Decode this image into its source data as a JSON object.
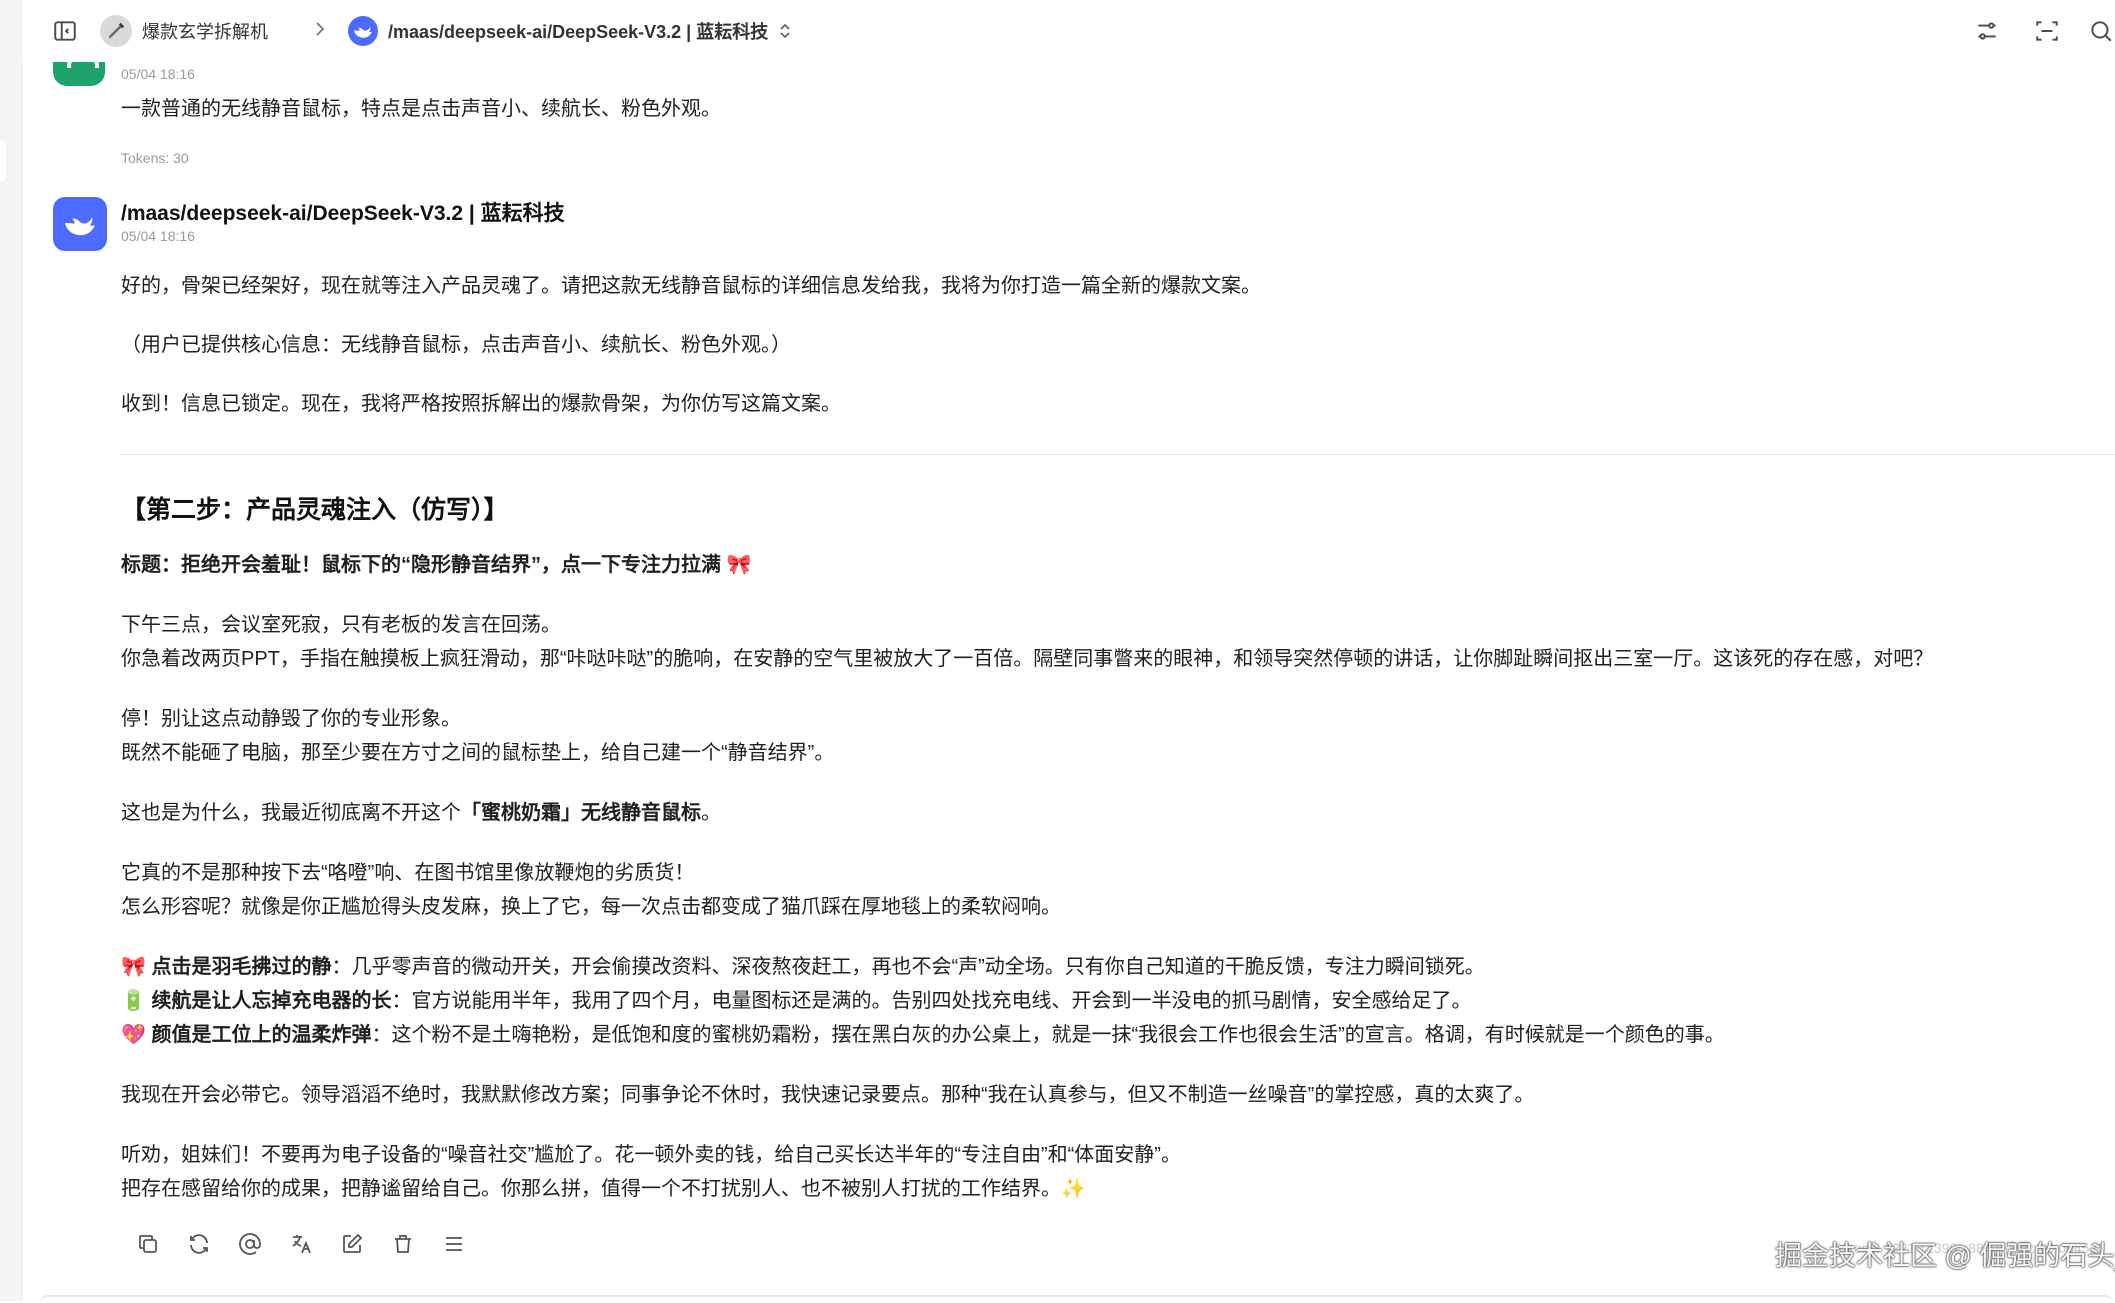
{
  "header": {
    "breadcrumb_agent": "爆款玄学拆解机",
    "breadcrumb_model": "/maas/deepseek-ai/DeepSeek-V3.2 | 蓝耘科技"
  },
  "user_message": {
    "time": "05/04 18:16",
    "text": "一款普通的无线静音鼠标，特点是点击声音小、续航长、粉色外观。",
    "tokens": "Tokens: 30"
  },
  "bot_message": {
    "name": "/maas/deepseek-ai/DeepSeek-V3.2 | 蓝耘科技",
    "time": "05/04 18:16",
    "p1": "好的，骨架已经架好，现在就等注入产品灵魂了。请把这款无线静音鼠标的详细信息发给我，我将为你打造一篇全新的爆款文案。",
    "p2": "（用户已提供核心信息：无线静音鼠标，点击声音小、续航长、粉色外观。）",
    "p3": "收到！信息已锁定。现在，我将严格按照拆解出的爆款骨架，为你仿写这篇文案。",
    "heading": "【第二步：产品灵魂注入（仿写）】",
    "title_line": "标题：拒绝开会羞耻！鼠标下的“隐形静音结界”，点一下专注力拉满 🎀",
    "l1": "下午三点，会议室死寂，只有老板的发言在回荡。",
    "l2": "你急着改两页PPT，手指在触摸板上疯狂滑动，那“咔哒咔哒”的脆响，在安静的空气里被放大了一百倍。隔壁同事瞥来的眼神，和领导突然停顿的讲话，让你脚趾瞬间抠出三室一厅。这该死的存在感，对吧？",
    "l3": "停！别让这点动静毁了你的专业形象。",
    "l4": "既然不能砸了电脑，那至少要在方寸之间的鼠标垫上，给自己建一个“静音结界”。",
    "l5_pre": "这也是为什么，我最近彻底离不开这个",
    "l5_bold": "「蜜桃奶霜」无线静音鼠标",
    "l5_post": "。",
    "l6": "它真的不是那种按下去“咯噔”响、在图书馆里像放鞭炮的劣质货！",
    "l7": "怎么形容呢？就像是你正尴尬得头皮发麻，换上了它，每一次点击都变成了猫爪踩在厚地毯上的柔软闷响。",
    "b1_icon": "🎀",
    "b1_bold": "点击是羽毛拂过的静",
    "b1_text": "：几乎零声音的微动开关，开会偷摸改资料、深夜熬夜赶工，再也不会“声”动全场。只有你自己知道的干脆反馈，专注力瞬间锁死。",
    "b2_icon": "🔋",
    "b2_bold": "续航是让人忘掉充电器的长",
    "b2_text": "：官方说能用半年，我用了四个月，电量图标还是满的。告别四处找充电线、开会到一半没电的抓马剧情，安全感给足了。",
    "b3_icon": "💖",
    "b3_bold": "颜值是工位上的温柔炸弹",
    "b3_text": "：这个粉不是土嗨艳粉，是低饱和度的蜜桃奶霜粉，摆在黑白灰的办公桌上，就是一抹“我很会工作也很会生活”的宣言。格调，有时候就是一个颜色的事。",
    "l8": "我现在开会必带它。领导滔滔不绝时，我默默修改方案；同事争论不休时，我快速记录要点。那种“我在认真参与，但又不制造一丝噪音”的掌控感，真的太爽了。",
    "l9": "听劝，姐妹们！不要再为电子设备的“噪音社交”尴尬了。花一顿外卖的钱，给自己买长达半年的“专注自由”和“体面安静”。",
    "l10": "把存在感留给你的成果，把静谧留给自己。你那么拼，值得一个不打扰别人、也不被别人打扰的工作结界。✨"
  },
  "footer_watermark": "掘金技术社区 @ 倔强的石头_",
  "footer_faint": "Tokens: 1221 ↑1390 ↓884 | 花费: ¥0.004522",
  "colors": {
    "accent": "#4d6bfe",
    "user_avatar": "#1ea36a"
  }
}
